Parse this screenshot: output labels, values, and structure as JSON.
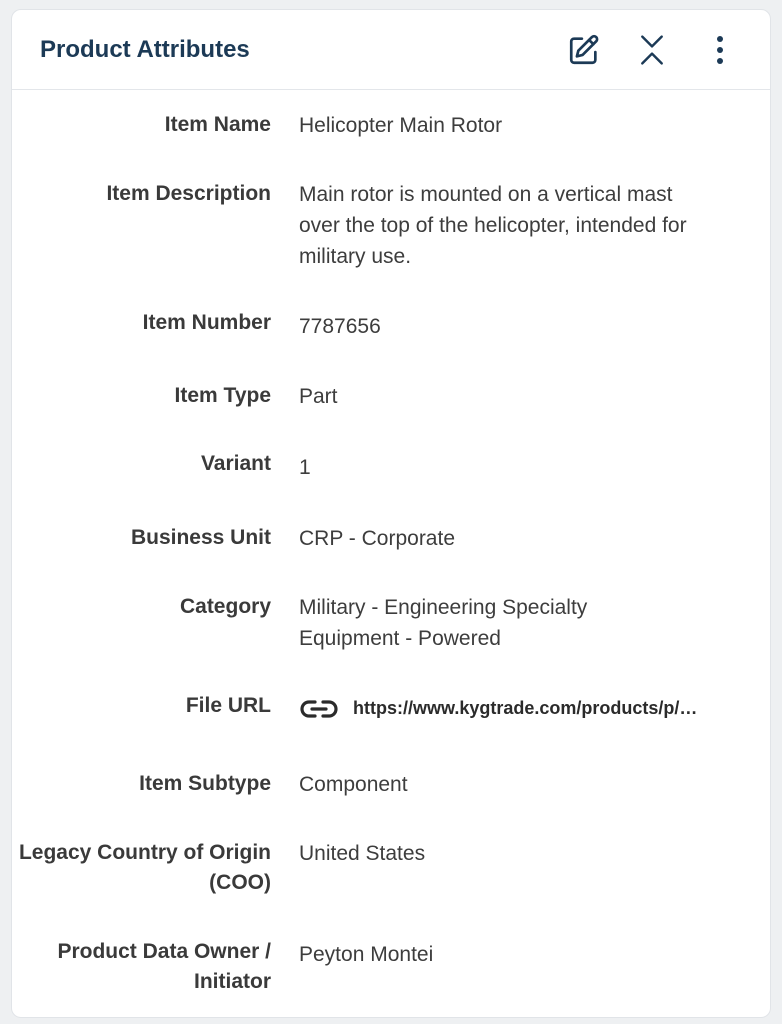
{
  "header": {
    "title": "Product Attributes",
    "icons": {
      "edit": "edit-icon",
      "collapse": "collapse-icon",
      "more": "more-vertical-icon"
    }
  },
  "attributes": [
    {
      "label": "Item Name",
      "value": "Helicopter Main Rotor"
    },
    {
      "label": "Item Description",
      "value": "Main rotor is mounted on a vertical mast over the top of the helicopter, intended for military use."
    },
    {
      "label": "Item Number",
      "value": "7787656"
    },
    {
      "label": "Item Type",
      "value": "Part"
    },
    {
      "label": "Variant",
      "value": "1"
    },
    {
      "label": "Business Unit",
      "value": "CRP - Corporate"
    },
    {
      "label": "Category",
      "value": "Military - Engineering Specialty Equipment - Powered"
    },
    {
      "label": "File URL",
      "value": "https://www.kygtrade.com/products/p/…",
      "icon": "link-icon"
    },
    {
      "label": "Item Subtype",
      "value": "Component"
    },
    {
      "label": "Legacy Country of Origin (COO)",
      "value": "United States"
    },
    {
      "label": "Product Data Owner / Initiator",
      "value": "Peyton Montei"
    }
  ],
  "colors": {
    "title": "#1c3a56",
    "label": "#3a3a3a",
    "value": "#3d3d3d"
  }
}
